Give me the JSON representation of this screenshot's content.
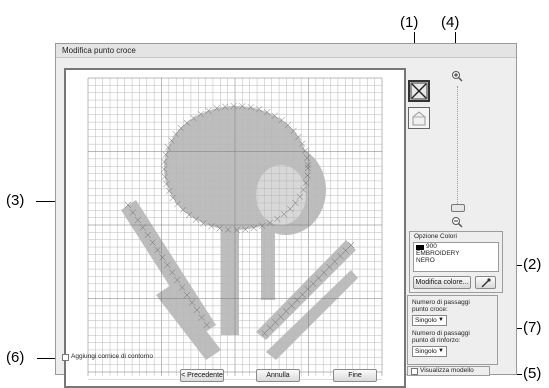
{
  "window": {
    "title": "Modifica punto croce"
  },
  "callouts": [
    "(1)",
    "(2)",
    "(3)",
    "(4)",
    "(5)",
    "(6)",
    "(7)"
  ],
  "color_options": {
    "group_label": "Opzione Colori",
    "color_number": "900",
    "color_line1": "EMBROIDERY",
    "color_line2": "NERO",
    "swatch_color": "#000000",
    "modify_button": "Modifica colore..."
  },
  "passes": {
    "cross_label_1": "Numero di passaggi",
    "cross_label_2": "punto croce:",
    "cross_value": "Singolo",
    "reinforce_label_1": "Numero di passaggi",
    "reinforce_label_2": "punto di rinforzo:",
    "reinforce_value": "Singolo"
  },
  "show_model_label": "Visualizza modello",
  "add_frame_label": "Aggiungi cornice di contorno",
  "buttons": {
    "previous": "< Precedente",
    "cancel": "Annulla",
    "finish": "Fine"
  },
  "icons": {
    "cross_stitch_tool": "cross-stitch-icon",
    "eraser_tool": "eraser-icon",
    "zoom_in": "zoom-in-icon",
    "zoom_out": "zoom-out-icon",
    "eyedropper": "eyedropper-icon"
  }
}
